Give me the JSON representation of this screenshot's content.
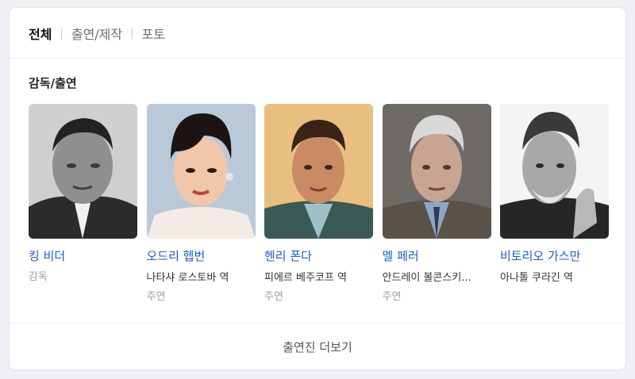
{
  "tabs": [
    "전체",
    "출연/제작",
    "포토"
  ],
  "section_title": "감독/출연",
  "people": [
    {
      "name": "킹 비더",
      "role": "",
      "job": "감독",
      "photo_icon": "person-photo-bw"
    },
    {
      "name": "오드리 헵번",
      "role": "나타샤 로스토바 역",
      "job": "주연",
      "photo_icon": "person-photo-color"
    },
    {
      "name": "헨리 폰다",
      "role": "피에르 베주코프 역",
      "job": "주연",
      "photo_icon": "person-photo-color"
    },
    {
      "name": "멜 페러",
      "role": "안드레이 볼콘스키...",
      "job": "주연",
      "photo_icon": "person-photo-color"
    },
    {
      "name": "비토리오 가스만",
      "role": "아나톨 쿠라긴 역",
      "job": "",
      "photo_icon": "person-photo-bw"
    }
  ],
  "more_label": "출연진 더보기",
  "colors": {
    "link": "#1a5fd6",
    "muted": "#9a9ea4",
    "page_bg": "#eef0f3"
  }
}
